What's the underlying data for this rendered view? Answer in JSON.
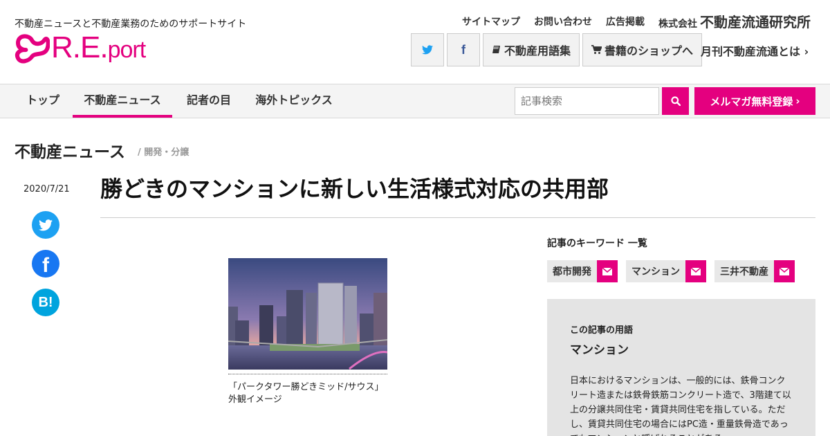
{
  "header": {
    "tagline": "不動産ニュースと不動産業務のためのサポートサイト",
    "logo_main": "R.E.",
    "logo_sub": "port",
    "links": [
      "サイトマップ",
      "お問い合わせ",
      "広告掲載"
    ],
    "corp_prefix": "株式会社",
    "corp_name": "不動産流通研究所",
    "buttons": {
      "glossary": "不動産用語集",
      "shop": "書籍のショップへ"
    },
    "about": "月刊不動産流通とは"
  },
  "nav": {
    "items": [
      "トップ",
      "不動産ニュース",
      "記者の目",
      "海外トピックス"
    ],
    "active_index": 1,
    "search_placeholder": "記事検索",
    "mail_button": "メルマガ無料登録"
  },
  "section": {
    "title": "不動産ニュース",
    "sub": "/ 開発・分譲"
  },
  "article": {
    "date": "2020/7/21",
    "title": "勝どきのマンションに新しい生活様式対応の共用部",
    "caption_line1": "「パークタワー勝どきミッド/サウス」",
    "caption_line2": "外観イメージ"
  },
  "keywords": {
    "title": "記事のキーワード 一覧",
    "items": [
      "都市開発",
      "マンション",
      "三井不動産"
    ]
  },
  "glossary": {
    "label": "この記事の用語",
    "term": "マンション",
    "description": "日本におけるマンションは、一般的には、鉄骨コンクリート造または鉄骨鉄筋コンクリート造で、3階建て以上の分譲共同住宅・賃貸共同住宅を指している。ただし、賃貸共同住宅の場合にはPC造・重量鉄骨造であってもマンションと呼ばれることがある。"
  },
  "colors": {
    "accent": "#e4007f",
    "twitter": "#1da1f2",
    "facebook": "#1877f2",
    "hatena": "#00a4de"
  },
  "icons": {
    "twitter": "twitter-icon",
    "facebook": "facebook-icon",
    "book": "book-icon",
    "cart": "cart-icon",
    "chevron": "chevron-right-icon",
    "search": "search-icon",
    "mail": "envelope-icon",
    "hatena": "hatena-bookmark-icon"
  }
}
